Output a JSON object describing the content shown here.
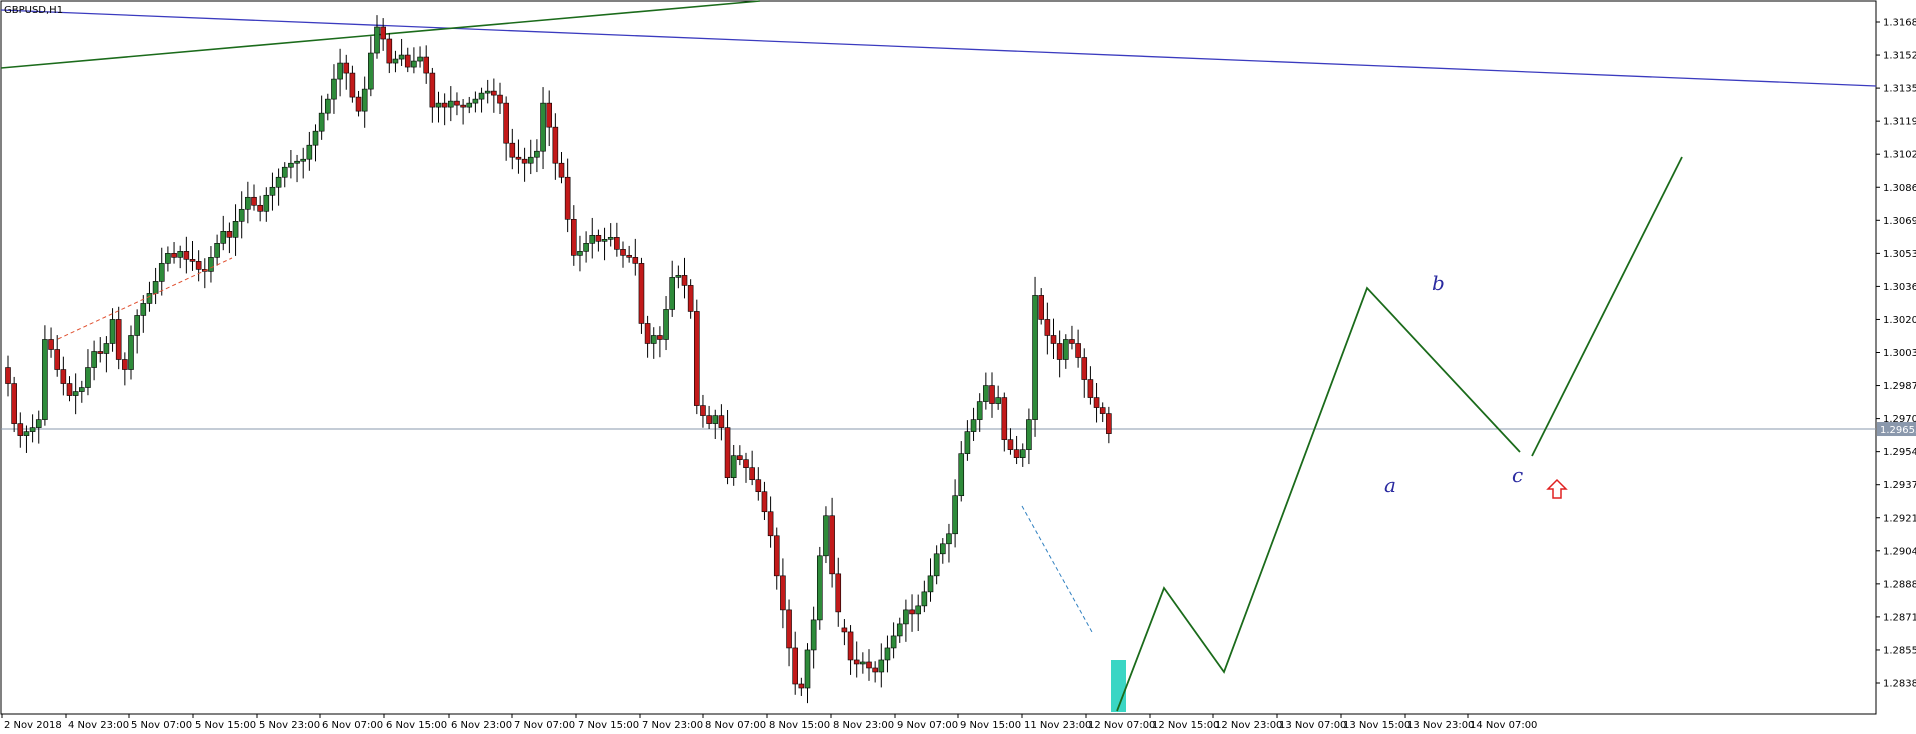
{
  "window": {
    "symbol_label": "GBPUSD,H1"
  },
  "current_price_label": "1.29653",
  "colors": {
    "bull": "#2e8b3a",
    "bear": "#c21a1a",
    "wick": "#000000",
    "trendline_green": "#1b6b1b",
    "trendline_blue": "#3b3bbf",
    "wave_label": "#2a2aa0",
    "projection": "#1b6b1b",
    "dashed_red": "#e05030",
    "dashed_blue": "#3080c0",
    "highlight": "#3ad6c4",
    "current_price_line": "#8a98ac",
    "arrow": "#e02020"
  },
  "annotations": {
    "wave_labels": [
      {
        "text": "a",
        "date": "13 Nov 15:00",
        "price": 1.2937
      },
      {
        "text": "b",
        "date": "13 Nov 23:00",
        "price": 1.3036
      },
      {
        "text": "c",
        "date": "14 Nov 07:00",
        "price": 1.2947
      }
    ],
    "arrow": {
      "icon": "up-arrow-icon",
      "date": "14 Nov 11:00",
      "price": 1.2938
    }
  },
  "chart_data": {
    "type": "candlestick",
    "title": "GBPUSD,H1",
    "ylim": [
      1.2827,
      1.3175
    ],
    "y_ticks": [
      "1.31685",
      "1.31520",
      "1.31355",
      "1.31190",
      "1.31025",
      "1.30860",
      "1.30695",
      "1.30530",
      "1.30365",
      "1.30200",
      "1.30035",
      "1.29870",
      "1.29705",
      "1.29540",
      "1.29375",
      "1.29210",
      "1.29045",
      "1.28880",
      "1.28715",
      "1.28550",
      "1.28385"
    ],
    "x_ticks": [
      "2 Nov 2018",
      "4 Nov 23:00",
      "5 Nov 07:00",
      "5 Nov 15:00",
      "5 Nov 23:00",
      "6 Nov 07:00",
      "6 Nov 15:00",
      "6 Nov 23:00",
      "7 Nov 07:00",
      "7 Nov 15:00",
      "7 Nov 23:00",
      "8 Nov 07:00",
      "8 Nov 15:00",
      "8 Nov 23:00",
      "9 Nov 07:00",
      "9 Nov 15:00",
      "11 Nov 23:00",
      "12 Nov 07:00",
      "12 Nov 15:00",
      "12 Nov 23:00",
      "13 Nov 07:00",
      "13 Nov 15:00",
      "13 Nov 23:00",
      "14 Nov 07:00"
    ],
    "current_price": 1.29653,
    "close_path": [
      1.2988,
      1.2968,
      1.2962,
      1.2964,
      1.2966,
      1.297,
      1.301,
      1.3005,
      1.2995,
      1.2988,
      1.2982,
      1.2984,
      1.2986,
      1.2996,
      1.3004,
      1.3003,
      1.3008,
      1.302,
      1.3,
      1.2995,
      1.3012,
      1.3022,
      1.3028,
      1.3033,
      1.3039,
      1.3048,
      1.3053,
      1.3051,
      1.3054,
      1.305,
      1.3049,
      1.3045,
      1.3044,
      1.3051,
      1.3058,
      1.3064,
      1.3061,
      1.3069,
      1.3075,
      1.3081,
      1.3077,
      1.3074,
      1.3082,
      1.3086,
      1.3091,
      1.3096,
      1.3098,
      1.3099,
      1.31,
      1.3107,
      1.3114,
      1.3123,
      1.313,
      1.314,
      1.3148,
      1.3143,
      1.3131,
      1.3124,
      1.3135,
      1.3153,
      1.3166,
      1.316,
      1.3148,
      1.315,
      1.3152,
      1.3146,
      1.3149,
      1.3151,
      1.3143,
      1.3126,
      1.3128,
      1.3126,
      1.3129,
      1.3127,
      1.3126,
      1.3128,
      1.313,
      1.3133,
      1.3134,
      1.3132,
      1.3128,
      1.3108,
      1.3101,
      1.31,
      1.3098,
      1.3101,
      1.3104,
      1.3128,
      1.3116,
      1.3098,
      1.3091,
      1.307,
      1.3052,
      1.3054,
      1.3058,
      1.3062,
      1.3059,
      1.306,
      1.3061,
      1.3055,
      1.3052,
      1.3051,
      1.3048,
      1.3018,
      1.3008,
      1.3012,
      1.301,
      1.3025,
      1.3041,
      1.3042,
      1.3037,
      1.3024,
      1.2977,
      1.2972,
      1.2968,
      1.2972,
      1.2966,
      1.2941,
      1.2952,
      1.295,
      1.2946,
      1.294,
      1.2934,
      1.2924,
      1.2912,
      1.2892,
      1.2875,
      1.2856,
      1.2838,
      1.2836,
      1.2855,
      1.287,
      1.2902,
      1.2922,
      1.2893,
      1.2874,
      1.2864,
      1.285,
      1.2848,
      1.2849,
      1.2846,
      1.2844,
      1.285,
      1.2856,
      1.2862,
      1.2868,
      1.2875,
      1.2873,
      1.2877,
      1.2884,
      1.2892,
      1.2903,
      1.2908,
      1.2913,
      1.2932,
      1.2953,
      1.2964,
      1.297,
      1.2979,
      1.2987,
      1.2978,
      1.2981,
      1.296,
      1.2955,
      1.2951,
      1.2955,
      1.297,
      1.3032,
      1.302,
      1.3012,
      1.3008,
      1.3,
      1.301,
      1.3008,
      1.3001,
      1.299,
      1.2981,
      1.2976,
      1.2973,
      1.2963
    ]
  }
}
